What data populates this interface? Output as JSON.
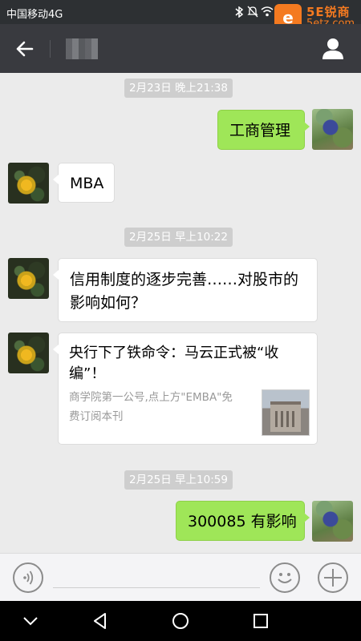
{
  "status_bar": {
    "carrier": "中国移动4G",
    "icons": [
      "bluetooth-icon",
      "mute-icon",
      "wifi-icon"
    ]
  },
  "watermark": {
    "logo_glyph": "e",
    "text": "5E锐商",
    "url": "5etz.com",
    "color": "#f47a20"
  },
  "nav": {
    "back_icon": "arrow-left-icon",
    "contact_name_blurred": true,
    "profile_icon": "person-icon"
  },
  "messages": [
    {
      "type": "timestamp",
      "text": "2月23日 晚上21:38"
    },
    {
      "type": "text",
      "side": "right",
      "text": "工商管理"
    },
    {
      "type": "text",
      "side": "left",
      "text": "MBA"
    },
    {
      "type": "timestamp",
      "text": "2月25日 早上10:22"
    },
    {
      "type": "text",
      "side": "left",
      "line1": "信用制度的逐步完善……对股市的",
      "line2": "影响如何？"
    },
    {
      "type": "article",
      "side": "left",
      "title1": "央行下了铁命令：马云正式被“收",
      "title2": "编”！",
      "desc1": "商学院第一公号,点上方\"EMBA\"免",
      "desc2": "费订阅本刊"
    },
    {
      "type": "timestamp",
      "text": "2月25日 早上10:59"
    },
    {
      "type": "text",
      "side": "right",
      "text": "300085 有影响"
    }
  ],
  "input_bar": {
    "voice_icon": "voice-icon",
    "emoji_icon": "emoji-icon",
    "plus_icon": "plus-icon",
    "input_value": ""
  },
  "nav_keys": [
    "chevron-down-icon",
    "back-triangle-icon",
    "home-circle-icon",
    "recents-square-icon"
  ],
  "colors": {
    "navbar": "#393a3f",
    "chat_bg": "#ebebeb",
    "bubble_green": "#9fe658",
    "bubble_white": "#ffffff",
    "timestamp_bg": "#cecece"
  }
}
